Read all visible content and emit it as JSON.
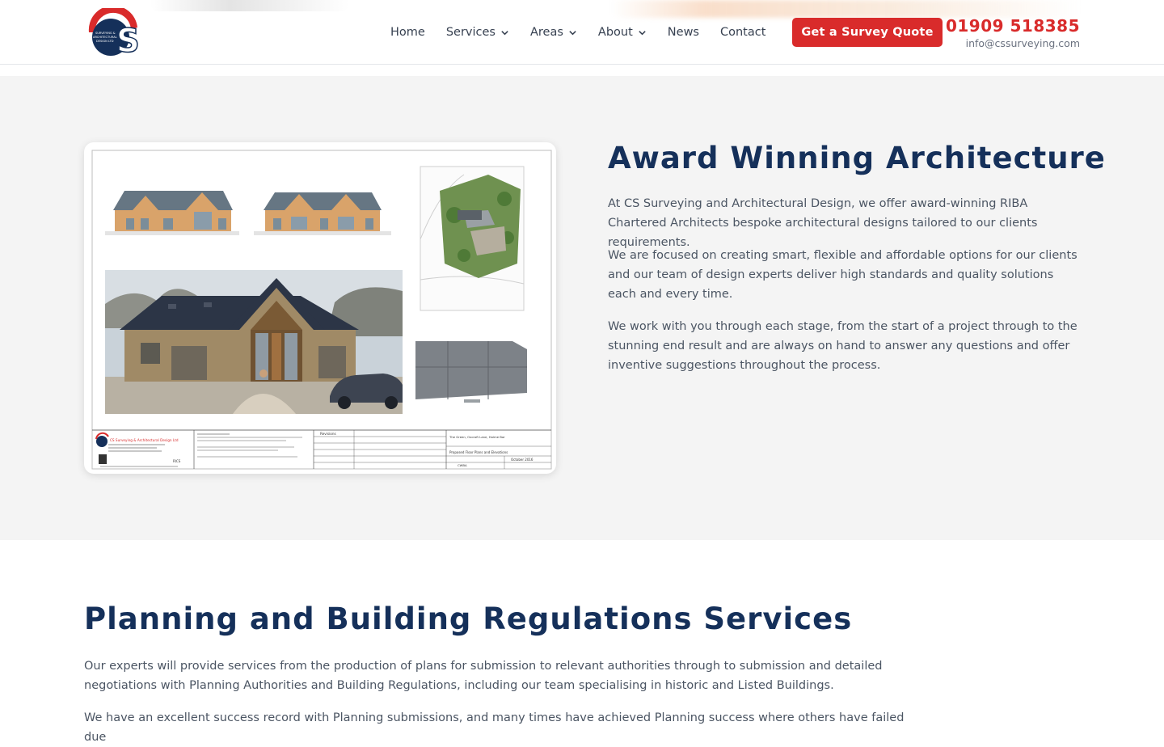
{
  "brand": {
    "logo_initials": "CS",
    "logo_text": "SURVEYING & ARCHITECTURAL DESIGN LTD",
    "accent": "#d92b2b",
    "navy": "#15305a"
  },
  "nav": {
    "items": [
      {
        "label": "Home",
        "has_dropdown": false
      },
      {
        "label": "Services",
        "has_dropdown": true
      },
      {
        "label": "Areas",
        "has_dropdown": true
      },
      {
        "label": "About",
        "has_dropdown": true
      },
      {
        "label": "News",
        "has_dropdown": false
      },
      {
        "label": "Contact",
        "has_dropdown": false
      }
    ],
    "cta_label": "Get a Survey Quote",
    "phone": "01909 518385",
    "email": "info@cssurveying.com"
  },
  "architecture": {
    "title": "Award Winning Architecture",
    "paragraphs": [
      "At CS Surveying and Architectural Design, we offer award-winning RIBA Chartered Architects bespoke architectural designs tailored to our clients requirements.",
      "We are focused on creating smart, flexible and affordable options for our clients and our team of design experts deliver high standards and quality solutions each and every time.",
      "We work with you through each stage, from the start of a project through to the stunning end result and are always on hand to answer any questions and offer inventive suggestions throughout the process."
    ],
    "drawing": {
      "company": "CS Surveying & Architectural Design Ltd",
      "revisions_label": "Revisions",
      "project": "The Green, Oxcroft Lane, Holme Bar",
      "sheet_title": "Proposed Floor Plans and Elevations",
      "date": "October 2016",
      "drawn_by": "CWBA",
      "org_badge": "RICS"
    }
  },
  "planning": {
    "title": "Planning and Building Regulations Services",
    "paragraphs": [
      "Our experts will provide services from the production of plans for submission to relevant authorities through to submission and detailed negotiations with Planning Authorities and Building Regulations, including our team specialising in historic and Listed Buildings.",
      "We have an excellent success record with Planning submissions, and many times have achieved Planning success where others have failed due"
    ]
  }
}
